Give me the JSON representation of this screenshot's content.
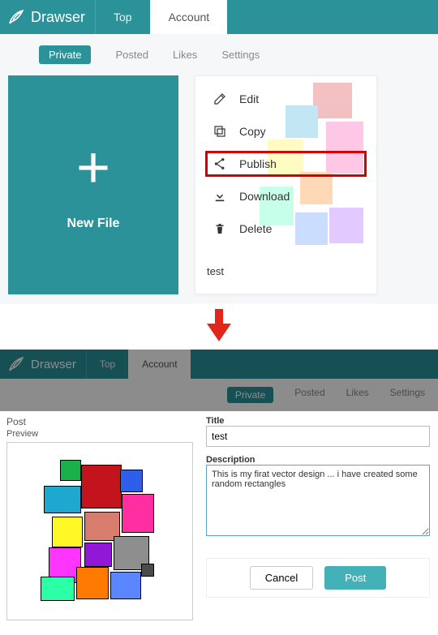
{
  "brand": "Drawser",
  "nav": {
    "top": "Top",
    "account": "Account"
  },
  "subtabs": {
    "private": "Private",
    "posted": "Posted",
    "likes": "Likes",
    "settings": "Settings"
  },
  "newfile": {
    "label": "New File"
  },
  "filecard": {
    "label": "test",
    "menu": {
      "edit": "Edit",
      "copy": "Copy",
      "publish": "Publish",
      "download": "Download",
      "delete": "Delete"
    }
  },
  "dialog": {
    "post_header": "Post",
    "preview_label": "Preview",
    "title_label": "Title",
    "title_value": "test",
    "description_label": "Description",
    "description_value": "This is my firat vector design ... i have created some random rectangles",
    "cancel": "Cancel",
    "post": "Post"
  }
}
